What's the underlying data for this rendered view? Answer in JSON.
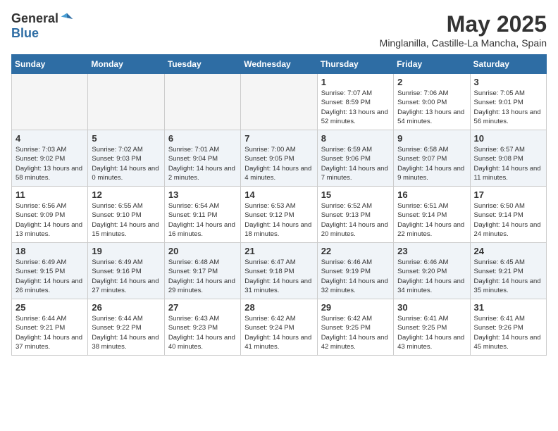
{
  "header": {
    "logo_general": "General",
    "logo_blue": "Blue",
    "month_title": "May 2025",
    "location": "Minglanilla, Castille-La Mancha, Spain"
  },
  "days_of_week": [
    "Sunday",
    "Monday",
    "Tuesday",
    "Wednesday",
    "Thursday",
    "Friday",
    "Saturday"
  ],
  "weeks": [
    {
      "alt": false,
      "days": [
        {
          "num": "",
          "empty": true
        },
        {
          "num": "",
          "empty": true
        },
        {
          "num": "",
          "empty": true
        },
        {
          "num": "",
          "empty": true
        },
        {
          "num": "1",
          "sunrise": "Sunrise: 7:07 AM",
          "sunset": "Sunset: 8:59 PM",
          "daylight": "Daylight: 13 hours and 52 minutes."
        },
        {
          "num": "2",
          "sunrise": "Sunrise: 7:06 AM",
          "sunset": "Sunset: 9:00 PM",
          "daylight": "Daylight: 13 hours and 54 minutes."
        },
        {
          "num": "3",
          "sunrise": "Sunrise: 7:05 AM",
          "sunset": "Sunset: 9:01 PM",
          "daylight": "Daylight: 13 hours and 56 minutes."
        }
      ]
    },
    {
      "alt": true,
      "days": [
        {
          "num": "4",
          "sunrise": "Sunrise: 7:03 AM",
          "sunset": "Sunset: 9:02 PM",
          "daylight": "Daylight: 13 hours and 58 minutes."
        },
        {
          "num": "5",
          "sunrise": "Sunrise: 7:02 AM",
          "sunset": "Sunset: 9:03 PM",
          "daylight": "Daylight: 14 hours and 0 minutes."
        },
        {
          "num": "6",
          "sunrise": "Sunrise: 7:01 AM",
          "sunset": "Sunset: 9:04 PM",
          "daylight": "Daylight: 14 hours and 2 minutes."
        },
        {
          "num": "7",
          "sunrise": "Sunrise: 7:00 AM",
          "sunset": "Sunset: 9:05 PM",
          "daylight": "Daylight: 14 hours and 4 minutes."
        },
        {
          "num": "8",
          "sunrise": "Sunrise: 6:59 AM",
          "sunset": "Sunset: 9:06 PM",
          "daylight": "Daylight: 14 hours and 7 minutes."
        },
        {
          "num": "9",
          "sunrise": "Sunrise: 6:58 AM",
          "sunset": "Sunset: 9:07 PM",
          "daylight": "Daylight: 14 hours and 9 minutes."
        },
        {
          "num": "10",
          "sunrise": "Sunrise: 6:57 AM",
          "sunset": "Sunset: 9:08 PM",
          "daylight": "Daylight: 14 hours and 11 minutes."
        }
      ]
    },
    {
      "alt": false,
      "days": [
        {
          "num": "11",
          "sunrise": "Sunrise: 6:56 AM",
          "sunset": "Sunset: 9:09 PM",
          "daylight": "Daylight: 14 hours and 13 minutes."
        },
        {
          "num": "12",
          "sunrise": "Sunrise: 6:55 AM",
          "sunset": "Sunset: 9:10 PM",
          "daylight": "Daylight: 14 hours and 15 minutes."
        },
        {
          "num": "13",
          "sunrise": "Sunrise: 6:54 AM",
          "sunset": "Sunset: 9:11 PM",
          "daylight": "Daylight: 14 hours and 16 minutes."
        },
        {
          "num": "14",
          "sunrise": "Sunrise: 6:53 AM",
          "sunset": "Sunset: 9:12 PM",
          "daylight": "Daylight: 14 hours and 18 minutes."
        },
        {
          "num": "15",
          "sunrise": "Sunrise: 6:52 AM",
          "sunset": "Sunset: 9:13 PM",
          "daylight": "Daylight: 14 hours and 20 minutes."
        },
        {
          "num": "16",
          "sunrise": "Sunrise: 6:51 AM",
          "sunset": "Sunset: 9:14 PM",
          "daylight": "Daylight: 14 hours and 22 minutes."
        },
        {
          "num": "17",
          "sunrise": "Sunrise: 6:50 AM",
          "sunset": "Sunset: 9:14 PM",
          "daylight": "Daylight: 14 hours and 24 minutes."
        }
      ]
    },
    {
      "alt": true,
      "days": [
        {
          "num": "18",
          "sunrise": "Sunrise: 6:49 AM",
          "sunset": "Sunset: 9:15 PM",
          "daylight": "Daylight: 14 hours and 26 minutes."
        },
        {
          "num": "19",
          "sunrise": "Sunrise: 6:49 AM",
          "sunset": "Sunset: 9:16 PM",
          "daylight": "Daylight: 14 hours and 27 minutes."
        },
        {
          "num": "20",
          "sunrise": "Sunrise: 6:48 AM",
          "sunset": "Sunset: 9:17 PM",
          "daylight": "Daylight: 14 hours and 29 minutes."
        },
        {
          "num": "21",
          "sunrise": "Sunrise: 6:47 AM",
          "sunset": "Sunset: 9:18 PM",
          "daylight": "Daylight: 14 hours and 31 minutes."
        },
        {
          "num": "22",
          "sunrise": "Sunrise: 6:46 AM",
          "sunset": "Sunset: 9:19 PM",
          "daylight": "Daylight: 14 hours and 32 minutes."
        },
        {
          "num": "23",
          "sunrise": "Sunrise: 6:46 AM",
          "sunset": "Sunset: 9:20 PM",
          "daylight": "Daylight: 14 hours and 34 minutes."
        },
        {
          "num": "24",
          "sunrise": "Sunrise: 6:45 AM",
          "sunset": "Sunset: 9:21 PM",
          "daylight": "Daylight: 14 hours and 35 minutes."
        }
      ]
    },
    {
      "alt": false,
      "days": [
        {
          "num": "25",
          "sunrise": "Sunrise: 6:44 AM",
          "sunset": "Sunset: 9:21 PM",
          "daylight": "Daylight: 14 hours and 37 minutes."
        },
        {
          "num": "26",
          "sunrise": "Sunrise: 6:44 AM",
          "sunset": "Sunset: 9:22 PM",
          "daylight": "Daylight: 14 hours and 38 minutes."
        },
        {
          "num": "27",
          "sunrise": "Sunrise: 6:43 AM",
          "sunset": "Sunset: 9:23 PM",
          "daylight": "Daylight: 14 hours and 40 minutes."
        },
        {
          "num": "28",
          "sunrise": "Sunrise: 6:42 AM",
          "sunset": "Sunset: 9:24 PM",
          "daylight": "Daylight: 14 hours and 41 minutes."
        },
        {
          "num": "29",
          "sunrise": "Sunrise: 6:42 AM",
          "sunset": "Sunset: 9:25 PM",
          "daylight": "Daylight: 14 hours and 42 minutes."
        },
        {
          "num": "30",
          "sunrise": "Sunrise: 6:41 AM",
          "sunset": "Sunset: 9:25 PM",
          "daylight": "Daylight: 14 hours and 43 minutes."
        },
        {
          "num": "31",
          "sunrise": "Sunrise: 6:41 AM",
          "sunset": "Sunset: 9:26 PM",
          "daylight": "Daylight: 14 hours and 45 minutes."
        }
      ]
    }
  ]
}
